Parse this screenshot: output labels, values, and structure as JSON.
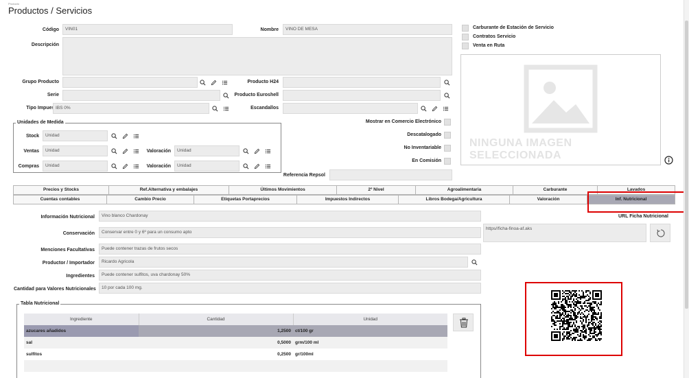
{
  "breadcrumb": "Producto",
  "title": "Productos / Servicios",
  "fields": {
    "codigo": {
      "label": "Código",
      "value": "VIN01"
    },
    "nombre": {
      "label": "Nombre",
      "value": "VINO DE MESA"
    },
    "descripcion": {
      "label": "Descripción",
      "value": ""
    },
    "grupo": {
      "label": "Grupo Producto",
      "value": ""
    },
    "serie": {
      "label": "Serie",
      "value": ""
    },
    "tipo_impuesto": {
      "label": "Tipo Impuesto",
      "value": "IBS 0%"
    },
    "h24": {
      "label": "Producto H24",
      "value": ""
    },
    "euroshell": {
      "label": "Producto Euroshell",
      "value": ""
    },
    "escandallos": {
      "label": "Escandallos",
      "value": ""
    },
    "referencia_repsol": {
      "label": "Referencia Repsol",
      "value": ""
    }
  },
  "checks": {
    "carburante": "Carburante de Estación de Servicio",
    "contratos": "Contratos Servicio",
    "venta_ruta": "Venta en Ruta",
    "comercio": "Mostrar en Comercio Electrónico",
    "descatalogado": "Descatalogado",
    "no_inventariable": "No Inventariable",
    "comision": "En Comisión"
  },
  "unidades": {
    "title": "Unidades de Medida",
    "stock": {
      "label": "Stock",
      "value": "Unidad"
    },
    "ventas": {
      "label": "Ventas",
      "value": "Unidad"
    },
    "compras": {
      "label": "Compras",
      "value": "Unidad"
    },
    "valoracion_label": "Valoración",
    "valoracion1": "Unidad",
    "valoracion2": "Unidad"
  },
  "image_placeholder": "NINGUNA IMAGEN SELECCIONADA",
  "tabs_row1": [
    "Precios y Stocks",
    "Ref.Alternativa y embalajes",
    "Últimos Movimientos",
    "2º Nivel",
    "Agroalimentaria",
    "Carburante",
    "Lavados"
  ],
  "tabs_row2": [
    "Cuentas contables",
    "Cambio Precio",
    "Etiquetas Portaprecios",
    "Impuestos Indirectos",
    "Libros Bodega/Agricultura",
    "Valoración",
    "Inf. Nutricional"
  ],
  "nutri": {
    "info": {
      "label": "Información Nutricional",
      "value": "Vino blanco Chardonay"
    },
    "conservacion": {
      "label": "Conservación",
      "value": "Conservar entre 0  y 6º para un consumo apto"
    },
    "menciones": {
      "label": "Menciones Facultativas",
      "value": "Puede contener trazas de frutos secos"
    },
    "productor": {
      "label": "Productor / Importador",
      "value": "Ricardo Agricola"
    },
    "ingredientes": {
      "label": "Ingredientes",
      "value": "Puede contener sulfitos, uva chardonay 50%"
    },
    "cantidad": {
      "label": "Cantidad para Valores Nutricionales",
      "value": "10 por cada 100 mg."
    },
    "url_label": "URL Ficha Nutricional",
    "url_value": "https//ficha-finoa-af.aks"
  },
  "tabla": {
    "title": "Tabla Nutricional",
    "headers": [
      "Ingrediente",
      "Cantidad",
      "Unidad"
    ],
    "rows": [
      {
        "ingrediente": "azucares añadidos",
        "cantidad": "1,2500",
        "unidad": "ct/100 gr"
      },
      {
        "ingrediente": "sal",
        "cantidad": "0,5000",
        "unidad": "grm/100 ml"
      },
      {
        "ingrediente": "sulfitos",
        "cantidad": "0,2500",
        "unidad": "gr/100ml"
      }
    ]
  },
  "icons": {
    "search": "search-icon",
    "edit": "pencil-icon",
    "list": "list-icon",
    "info": "info-icon",
    "refresh": "refresh-icon",
    "trash": "trash-icon"
  },
  "colors": {
    "active_tab": "#a8a8b4",
    "selected_row": "#a8a8b4",
    "highlight": "#dd0000"
  }
}
